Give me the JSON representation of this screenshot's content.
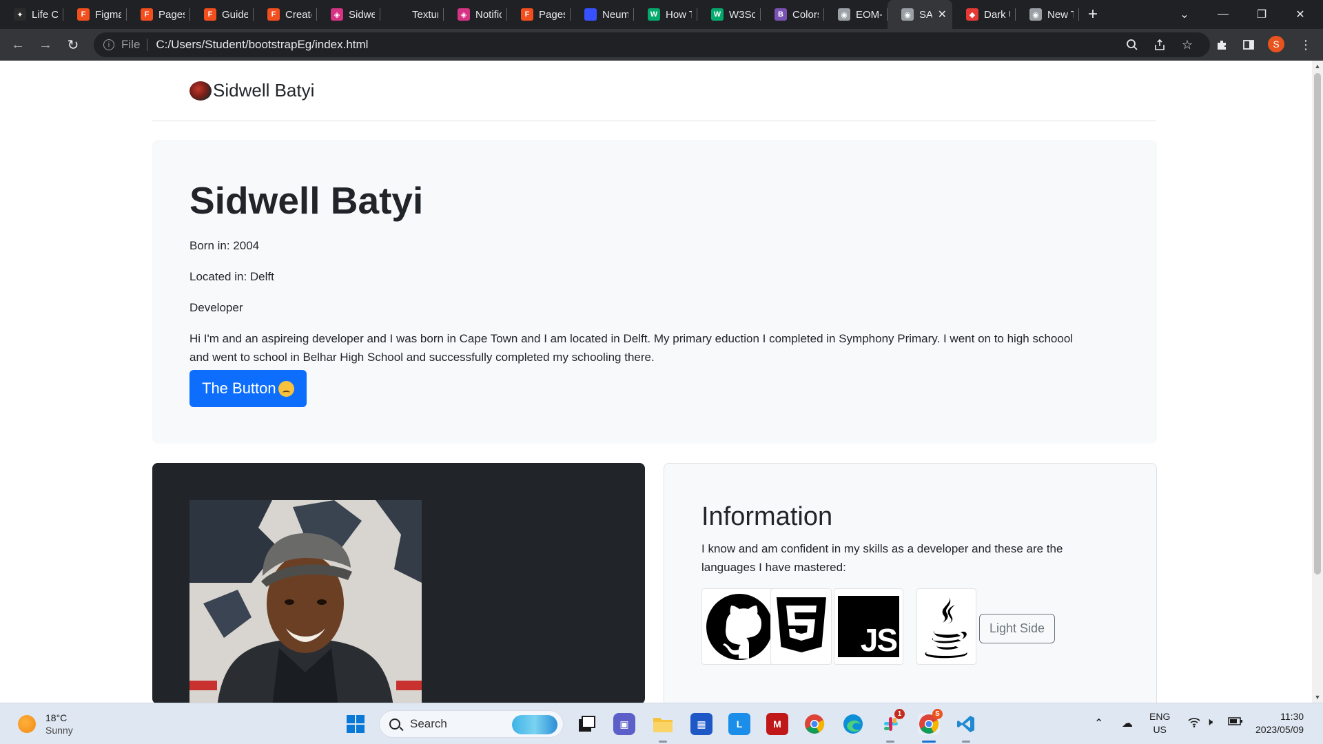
{
  "browser": {
    "tabs": [
      {
        "label": "Life Cl",
        "color": "#2b2b2b",
        "glyph": "✦"
      },
      {
        "label": "Figma",
        "color": "#f24e1e",
        "glyph": "F"
      },
      {
        "label": "Pages",
        "color": "#f24e1e",
        "glyph": "F"
      },
      {
        "label": "Guide",
        "color": "#f24e1e",
        "glyph": "F"
      },
      {
        "label": "Create",
        "color": "#f24e1e",
        "glyph": "F"
      },
      {
        "label": "Sidwel",
        "color": "#d63384",
        "glyph": "◈"
      },
      {
        "label": "Textur",
        "color": "#202124",
        "glyph": ""
      },
      {
        "label": "Notific",
        "color": "#d63384",
        "glyph": "◈"
      },
      {
        "label": "Pages",
        "color": "#f24e1e",
        "glyph": "F"
      },
      {
        "label": "Neum",
        "color": "#3751ff",
        "glyph": ""
      },
      {
        "label": "How T",
        "color": "#04aa6d",
        "glyph": "W"
      },
      {
        "label": "W3Sc",
        "color": "#04aa6d",
        "glyph": "W"
      },
      {
        "label": "Colors",
        "color": "#7952b3",
        "glyph": "B"
      },
      {
        "label": "EOM-I",
        "color": "#9aa0a6",
        "glyph": "◉"
      },
      {
        "label": "SA",
        "color": "#9aa0a6",
        "glyph": "◉",
        "active": true
      },
      {
        "label": "Dark U",
        "color": "#e53935",
        "glyph": "◆"
      },
      {
        "label": "New T",
        "color": "#9aa0a6",
        "glyph": "◉"
      }
    ],
    "address": {
      "scheme": "File",
      "url": "C:/Users/Student/bootstrapEg/index.html"
    },
    "profile_initial": "S"
  },
  "page": {
    "brand": "Sidwell Batyi",
    "hero": {
      "title": "Sidwell Batyi",
      "born": "Born in: 2004",
      "located": "Located in: Delft",
      "role": "Developer",
      "bio": "Hi I'm and an aspireing developer and I was born in Cape Town and I am located in Delft. My primary eduction I completed in Symphony Primary. I went on to high schoool and went to school in Belhar High School and successfully completed my schooling there.",
      "button_label": "The Button"
    },
    "info": {
      "heading": "Information",
      "description": "I know and am confident in my skills as a developer and these are the languages I have mastered:",
      "logos": [
        "github-logo",
        "html5-logo",
        "javascript-logo",
        "java-logo"
      ],
      "js_text": "JS",
      "html_text": "5",
      "outline_button": "Light Side"
    }
  },
  "taskbar": {
    "weather_temp": "18°C",
    "weather_desc": "Sunny",
    "search_label": "Search",
    "lang_top": "ENG",
    "lang_bottom": "US",
    "time": "11:30",
    "date": "2023/05/09",
    "slack_badge": "1",
    "chrome_badge": "S"
  },
  "colors": {
    "primary": "#0d6efd",
    "dark_card": "#212529",
    "hero_bg": "#f8f9fa",
    "chrome_dark": "#202124"
  }
}
